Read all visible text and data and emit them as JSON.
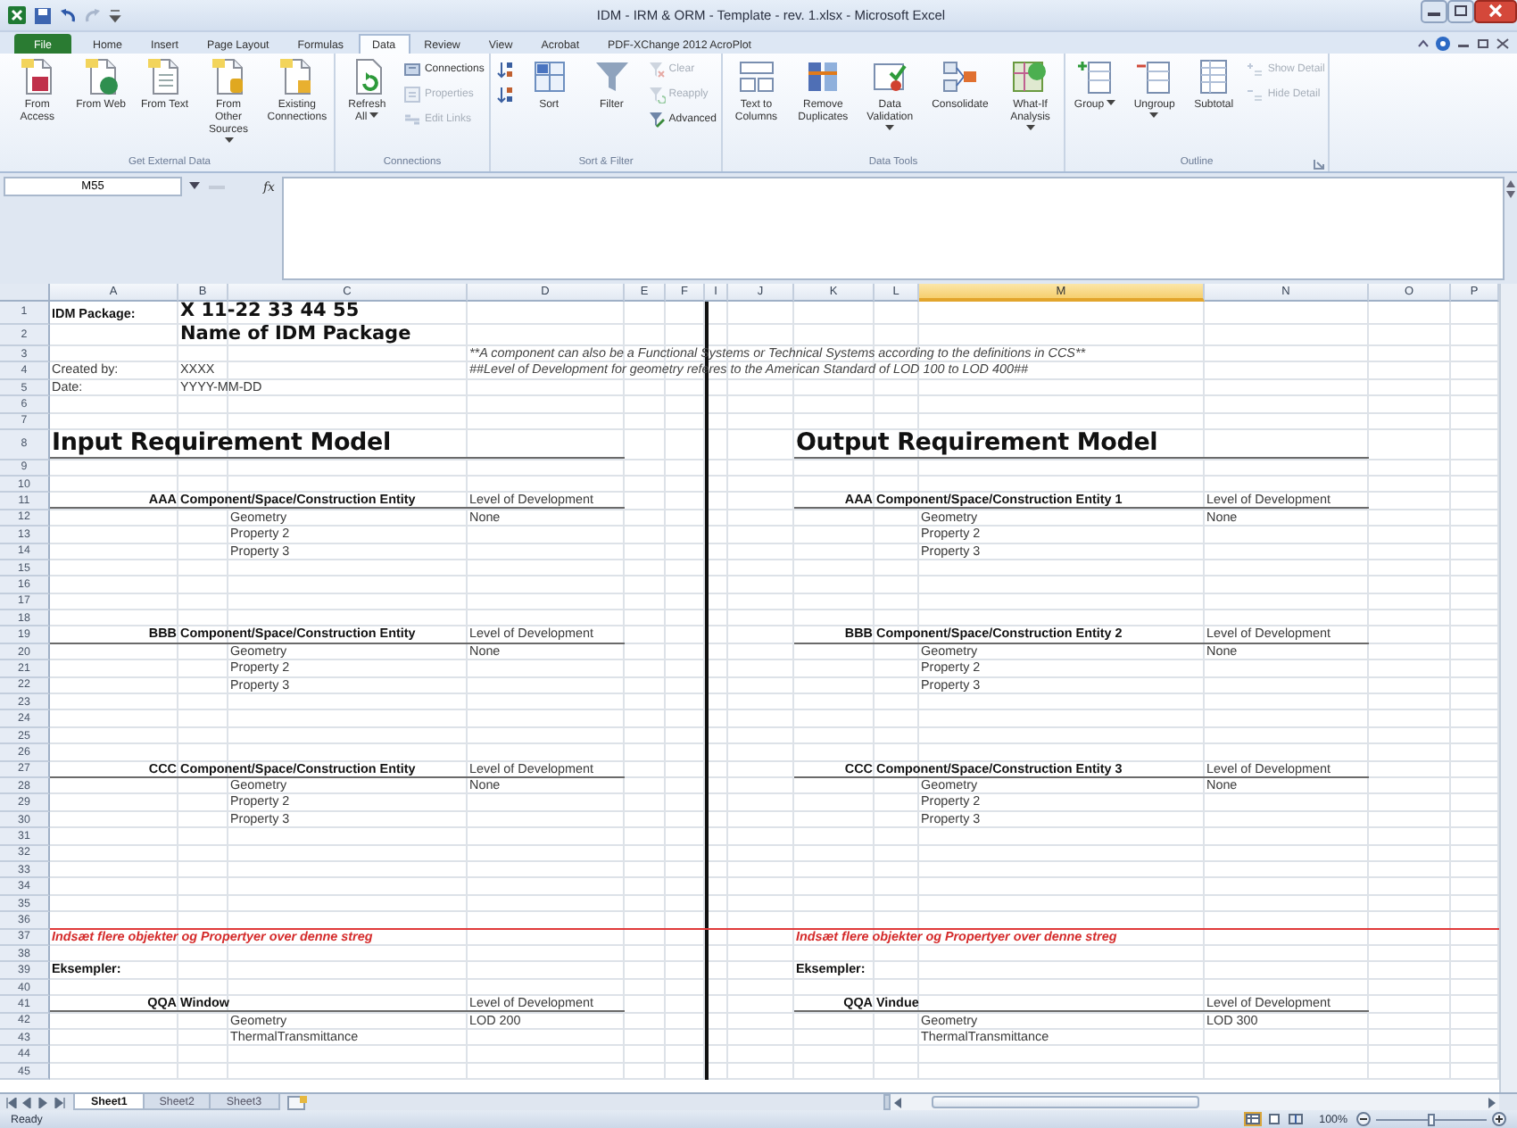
{
  "window": {
    "title": "IDM - IRM & ORM - Template - rev. 1.xlsx - Microsoft Excel"
  },
  "tabs": [
    {
      "label": "File",
      "kind": "file",
      "selected": false
    },
    {
      "label": "Home",
      "kind": "tab",
      "selected": false
    },
    {
      "label": "Insert",
      "kind": "tab",
      "selected": false
    },
    {
      "label": "Page Layout",
      "kind": "tab",
      "selected": false
    },
    {
      "label": "Formulas",
      "kind": "tab",
      "selected": false
    },
    {
      "label": "Data",
      "kind": "tab",
      "selected": true
    },
    {
      "label": "Review",
      "kind": "tab",
      "selected": false
    },
    {
      "label": "View",
      "kind": "tab",
      "selected": false
    },
    {
      "label": "Acrobat",
      "kind": "tab",
      "selected": false
    },
    {
      "label": "PDF-XChange 2012 AcroPlot",
      "kind": "tab",
      "selected": false
    }
  ],
  "ribbon": [
    {
      "label": "Get External Data",
      "launcher": false,
      "buttons": [
        {
          "label": "From Access",
          "kind": "large",
          "disabled": false,
          "dropdown": false
        },
        {
          "label": "From Web",
          "kind": "large",
          "disabled": false,
          "dropdown": false
        },
        {
          "label": "From Text",
          "kind": "large",
          "disabled": false,
          "dropdown": false
        },
        {
          "label": "From Other Sources",
          "kind": "large",
          "disabled": false,
          "dropdown": true
        },
        {
          "label": "Existing Connections",
          "kind": "large",
          "disabled": false,
          "dropdown": false
        }
      ]
    },
    {
      "label": "Connections",
      "launcher": false,
      "buttons": [
        {
          "label": "Refresh All",
          "kind": "large",
          "disabled": false,
          "dropdown": true
        },
        {
          "label": "Connections",
          "kind": "small",
          "disabled": false,
          "dropdown": false
        },
        {
          "label": "Properties",
          "kind": "small",
          "disabled": true,
          "dropdown": false
        },
        {
          "label": "Edit Links",
          "kind": "small",
          "disabled": true,
          "dropdown": false
        }
      ]
    },
    {
      "label": "Sort & Filter",
      "launcher": false,
      "buttons": [
        {
          "kind": "icon",
          "disabled": false,
          "dropdown": false
        },
        {
          "kind": "icon",
          "disabled": false,
          "dropdown": false
        },
        {
          "label": "Sort",
          "kind": "large",
          "disabled": false,
          "dropdown": false
        },
        {
          "label": "Filter",
          "kind": "large",
          "disabled": false,
          "dropdown": false
        },
        {
          "label": "Clear",
          "kind": "small",
          "disabled": true,
          "dropdown": false
        },
        {
          "label": "Reapply",
          "kind": "small",
          "disabled": true,
          "dropdown": false
        },
        {
          "label": "Advanced",
          "kind": "small",
          "disabled": false,
          "dropdown": false
        }
      ]
    },
    {
      "label": "Data Tools",
      "launcher": false,
      "buttons": [
        {
          "label": "Text to Columns",
          "kind": "large",
          "disabled": false,
          "dropdown": false
        },
        {
          "label": "Remove Duplicates",
          "kind": "large",
          "disabled": false,
          "dropdown": false
        },
        {
          "label": "Data Validation",
          "kind": "large",
          "disabled": false,
          "dropdown": true
        },
        {
          "label": "Consolidate",
          "kind": "large",
          "disabled": false,
          "dropdown": false
        },
        {
          "label": "What-If Analysis",
          "kind": "large",
          "disabled": false,
          "dropdown": true
        }
      ]
    },
    {
      "label": "Outline",
      "launcher": true,
      "buttons": [
        {
          "label": "Group",
          "kind": "large",
          "disabled": false,
          "dropdown": true
        },
        {
          "label": "Ungroup",
          "kind": "large",
          "disabled": false,
          "dropdown": true
        },
        {
          "label": "Subtotal",
          "kind": "large",
          "disabled": false,
          "dropdown": false
        },
        {
          "label": "Show Detail",
          "kind": "small",
          "disabled": true,
          "dropdown": false
        },
        {
          "label": "Hide Detail",
          "kind": "small",
          "disabled": true,
          "dropdown": false
        }
      ]
    }
  ],
  "formula_bar": {
    "name_box": "M55",
    "function_label": "fx"
  },
  "columns": [
    {
      "label": "A",
      "selected": false
    },
    {
      "label": "B",
      "selected": false
    },
    {
      "label": "C",
      "selected": false
    },
    {
      "label": "D",
      "selected": false
    },
    {
      "label": "E",
      "selected": false
    },
    {
      "label": "F",
      "selected": false
    },
    {
      "label": "I",
      "selected": false
    },
    {
      "label": "J",
      "selected": false
    },
    {
      "label": "K",
      "selected": false
    },
    {
      "label": "L",
      "selected": false
    },
    {
      "label": "M",
      "selected": true
    },
    {
      "label": "N",
      "selected": false
    },
    {
      "label": "O",
      "selected": false
    },
    {
      "label": "P",
      "selected": false
    }
  ],
  "rows": [
    {
      "number": "1",
      "section_rule": false,
      "insert_rule": false,
      "input": [
        {
          "kind": "heading",
          "text": "IDM Package:"
        },
        {
          "kind": "package",
          "text": "X 11-22 33 44 55"
        }
      ]
    },
    {
      "number": "2",
      "section_rule": false,
      "insert_rule": false,
      "input": [
        {
          "kind": "package",
          "text": "Name of IDM Package"
        }
      ]
    },
    {
      "number": "3",
      "section_rule": false,
      "insert_rule": false,
      "input": [
        {
          "kind": "note",
          "text": "**A component can also be a Functional Systems or Technical Systems according to the definitions in CCS**"
        }
      ]
    },
    {
      "number": "4",
      "section_rule": false,
      "insert_rule": false,
      "input": [
        {
          "kind": "label",
          "text": "Created by:"
        },
        {
          "kind": "value",
          "text": "XXXX"
        },
        {
          "kind": "note",
          "text": "##Level of Development for geometry referes to the American Standard of LOD 100 to LOD 400##"
        }
      ]
    },
    {
      "number": "5",
      "section_rule": false,
      "insert_rule": false,
      "input": [
        {
          "kind": "label",
          "text": "Date:"
        },
        {
          "kind": "value",
          "text": "YYYY-MM-DD"
        }
      ]
    },
    {
      "number": "6",
      "section_rule": false,
      "insert_rule": false
    },
    {
      "number": "7",
      "section_rule": false,
      "insert_rule": false
    },
    {
      "number": "8",
      "section_rule": true,
      "insert_rule": false,
      "input": [
        {
          "kind": "title",
          "text": "Input Requirement Model"
        }
      ],
      "output": [
        {
          "kind": "title",
          "text": "Output Requirement Model"
        }
      ]
    },
    {
      "number": "9",
      "section_rule": false,
      "insert_rule": false
    },
    {
      "number": "10",
      "section_rule": false,
      "insert_rule": false
    },
    {
      "number": "11",
      "section_rule": true,
      "insert_rule": false,
      "input": [
        {
          "kind": "code",
          "text": "AAA"
        },
        {
          "kind": "entity",
          "text": "Component/Space/Construction Entity"
        },
        {
          "kind": "lod",
          "text": "Level of Development"
        }
      ],
      "output": [
        {
          "kind": "code",
          "text": "AAA"
        },
        {
          "kind": "entity",
          "text": "Component/Space/Construction Entity 1"
        },
        {
          "kind": "lod",
          "text": "Level of Development"
        }
      ]
    },
    {
      "number": "12",
      "section_rule": false,
      "insert_rule": false,
      "input": [
        {
          "kind": "property",
          "text": "Geometry"
        },
        {
          "kind": "lod",
          "text": "None"
        }
      ],
      "output": [
        {
          "kind": "property",
          "text": "Geometry"
        },
        {
          "kind": "lod",
          "text": "None"
        }
      ]
    },
    {
      "number": "13",
      "section_rule": false,
      "insert_rule": false,
      "input": [
        {
          "kind": "property",
          "text": "Property 2"
        }
      ],
      "output": [
        {
          "kind": "property",
          "text": "Property 2"
        }
      ]
    },
    {
      "number": "14",
      "section_rule": false,
      "insert_rule": false,
      "input": [
        {
          "kind": "property",
          "text": "Property 3"
        }
      ],
      "output": [
        {
          "kind": "property",
          "text": "Property 3"
        }
      ]
    },
    {
      "number": "15",
      "section_rule": false,
      "insert_rule": false
    },
    {
      "number": "16",
      "section_rule": false,
      "insert_rule": false
    },
    {
      "number": "17",
      "section_rule": false,
      "insert_rule": false
    },
    {
      "number": "18",
      "section_rule": false,
      "insert_rule": false
    },
    {
      "number": "19",
      "section_rule": true,
      "insert_rule": false,
      "input": [
        {
          "kind": "code",
          "text": "BBB"
        },
        {
          "kind": "entity",
          "text": "Component/Space/Construction Entity"
        },
        {
          "kind": "lod",
          "text": "Level of Development"
        }
      ],
      "output": [
        {
          "kind": "code",
          "text": "BBB"
        },
        {
          "kind": "entity",
          "text": "Component/Space/Construction Entity 2"
        },
        {
          "kind": "lod",
          "text": "Level of Development"
        }
      ]
    },
    {
      "number": "20",
      "section_rule": false,
      "insert_rule": false,
      "input": [
        {
          "kind": "property",
          "text": "Geometry"
        },
        {
          "kind": "lod",
          "text": "None"
        }
      ],
      "output": [
        {
          "kind": "property",
          "text": "Geometry"
        },
        {
          "kind": "lod",
          "text": "None"
        }
      ]
    },
    {
      "number": "21",
      "section_rule": false,
      "insert_rule": false,
      "input": [
        {
          "kind": "property",
          "text": "Property 2"
        }
      ],
      "output": [
        {
          "kind": "property",
          "text": "Property 2"
        }
      ]
    },
    {
      "number": "22",
      "section_rule": false,
      "insert_rule": false,
      "input": [
        {
          "kind": "property",
          "text": "Property 3"
        }
      ],
      "output": [
        {
          "kind": "property",
          "text": "Property 3"
        }
      ]
    },
    {
      "number": "23",
      "section_rule": false,
      "insert_rule": false
    },
    {
      "number": "24",
      "section_rule": false,
      "insert_rule": false
    },
    {
      "number": "25",
      "section_rule": false,
      "insert_rule": false
    },
    {
      "number": "26",
      "section_rule": false,
      "insert_rule": false
    },
    {
      "number": "27",
      "section_rule": true,
      "insert_rule": false,
      "input": [
        {
          "kind": "code",
          "text": "CCC"
        },
        {
          "kind": "entity",
          "text": "Component/Space/Construction Entity"
        },
        {
          "kind": "lod",
          "text": "Level of Development"
        }
      ],
      "output": [
        {
          "kind": "code",
          "text": "CCC"
        },
        {
          "kind": "entity",
          "text": "Component/Space/Construction Entity 3"
        },
        {
          "kind": "lod",
          "text": "Level of Development"
        }
      ]
    },
    {
      "number": "28",
      "section_rule": false,
      "insert_rule": false,
      "input": [
        {
          "kind": "property",
          "text": "Geometry"
        },
        {
          "kind": "lod",
          "text": "None"
        }
      ],
      "output": [
        {
          "kind": "property",
          "text": "Geometry"
        },
        {
          "kind": "lod",
          "text": "None"
        }
      ]
    },
    {
      "number": "29",
      "section_rule": false,
      "insert_rule": false,
      "input": [
        {
          "kind": "property",
          "text": "Property 2"
        }
      ],
      "output": [
        {
          "kind": "property",
          "text": "Property 2"
        }
      ]
    },
    {
      "number": "30",
      "section_rule": false,
      "insert_rule": false,
      "input": [
        {
          "kind": "property",
          "text": "Property 3"
        }
      ],
      "output": [
        {
          "kind": "property",
          "text": "Property 3"
        }
      ]
    },
    {
      "number": "31",
      "section_rule": false,
      "insert_rule": false
    },
    {
      "number": "32",
      "section_rule": false,
      "insert_rule": false
    },
    {
      "number": "33",
      "section_rule": false,
      "insert_rule": false
    },
    {
      "number": "34",
      "section_rule": false,
      "insert_rule": false
    },
    {
      "number": "35",
      "section_rule": false,
      "insert_rule": false
    },
    {
      "number": "36",
      "section_rule": false,
      "insert_rule": true
    },
    {
      "number": "37",
      "section_rule": false,
      "insert_rule": false,
      "input": [
        {
          "kind": "warning",
          "text": "Indsæt flere objekter og Propertyer over denne streg"
        }
      ],
      "output": [
        {
          "kind": "warning",
          "text": "Indsæt flere objekter og Propertyer over denne streg"
        }
      ]
    },
    {
      "number": "38",
      "section_rule": false,
      "insert_rule": false
    },
    {
      "number": "39",
      "section_rule": false,
      "insert_rule": false,
      "input": [
        {
          "kind": "heading",
          "text": "Eksempler:"
        }
      ],
      "output": [
        {
          "kind": "heading",
          "text": "Eksempler:"
        }
      ]
    },
    {
      "number": "40",
      "section_rule": false,
      "insert_rule": false
    },
    {
      "number": "41",
      "section_rule": true,
      "insert_rule": false,
      "input": [
        {
          "kind": "code",
          "text": "QQA"
        },
        {
          "kind": "entity",
          "text": "Window"
        },
        {
          "kind": "lod",
          "text": "Level of Development"
        }
      ],
      "output": [
        {
          "kind": "code",
          "text": "QQA"
        },
        {
          "kind": "entity",
          "text": "Vindue"
        },
        {
          "kind": "lod",
          "text": "Level of Development"
        }
      ]
    },
    {
      "number": "42",
      "section_rule": false,
      "insert_rule": false,
      "input": [
        {
          "kind": "property",
          "text": "Geometry"
        },
        {
          "kind": "lod",
          "text": "LOD 200"
        }
      ],
      "output": [
        {
          "kind": "property",
          "text": "Geometry"
        },
        {
          "kind": "lod",
          "text": "LOD 300"
        }
      ]
    },
    {
      "number": "43",
      "section_rule": false,
      "insert_rule": false,
      "input": [
        {
          "kind": "property",
          "text": "ThermalTransmittance"
        }
      ],
      "output": [
        {
          "kind": "property",
          "text": "ThermalTransmittance"
        }
      ]
    },
    {
      "number": "44",
      "section_rule": false,
      "insert_rule": false
    },
    {
      "number": "45",
      "section_rule": false,
      "insert_rule": false
    }
  ],
  "sheet_tabs": [
    {
      "label": "Sheet1",
      "selected": true
    },
    {
      "label": "Sheet2",
      "selected": false
    },
    {
      "label": "Sheet3",
      "selected": false
    }
  ],
  "status_bar": {
    "text": "Ready",
    "views": [
      {
        "kind": "normal",
        "selected": true
      },
      {
        "kind": "page-layout",
        "selected": false
      },
      {
        "kind": "page-break",
        "selected": false
      }
    ],
    "zoom": "100%",
    "zoom_slider": {
      "level": 0.5
    }
  }
}
